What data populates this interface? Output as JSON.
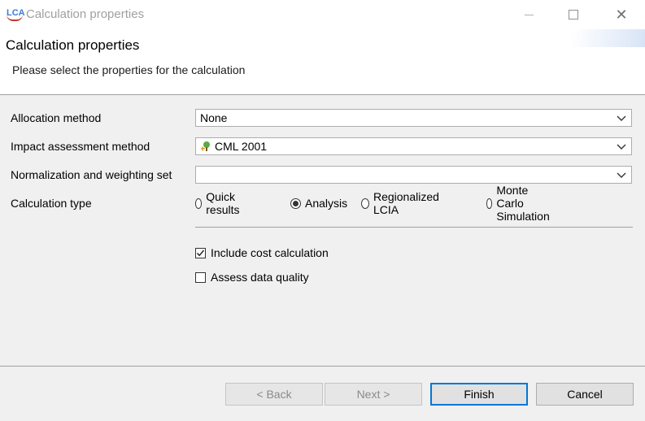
{
  "window": {
    "app_icon_text": "LCA",
    "title": "Calculation properties"
  },
  "header": {
    "title": "Calculation properties",
    "description": "Please select the properties for the calculation"
  },
  "form": {
    "allocation": {
      "label": "Allocation method",
      "value": "None"
    },
    "impact": {
      "label": "Impact assessment method",
      "value": "CML 2001",
      "icon": "lcia-method-icon"
    },
    "normalization": {
      "label": "Normalization and weighting set",
      "value": ""
    },
    "calc_type": {
      "label": "Calculation type",
      "options": [
        "Quick results",
        "Analysis",
        "Regionalized LCIA",
        "Monte Carlo Simulation"
      ],
      "selected": "Analysis"
    },
    "include_cost": {
      "label": "Include cost calculation",
      "checked": true
    },
    "assess_quality": {
      "label": "Assess data quality",
      "checked": false
    }
  },
  "buttons": {
    "back": "< Back",
    "next": "Next >",
    "finish": "Finish",
    "cancel": "Cancel"
  }
}
